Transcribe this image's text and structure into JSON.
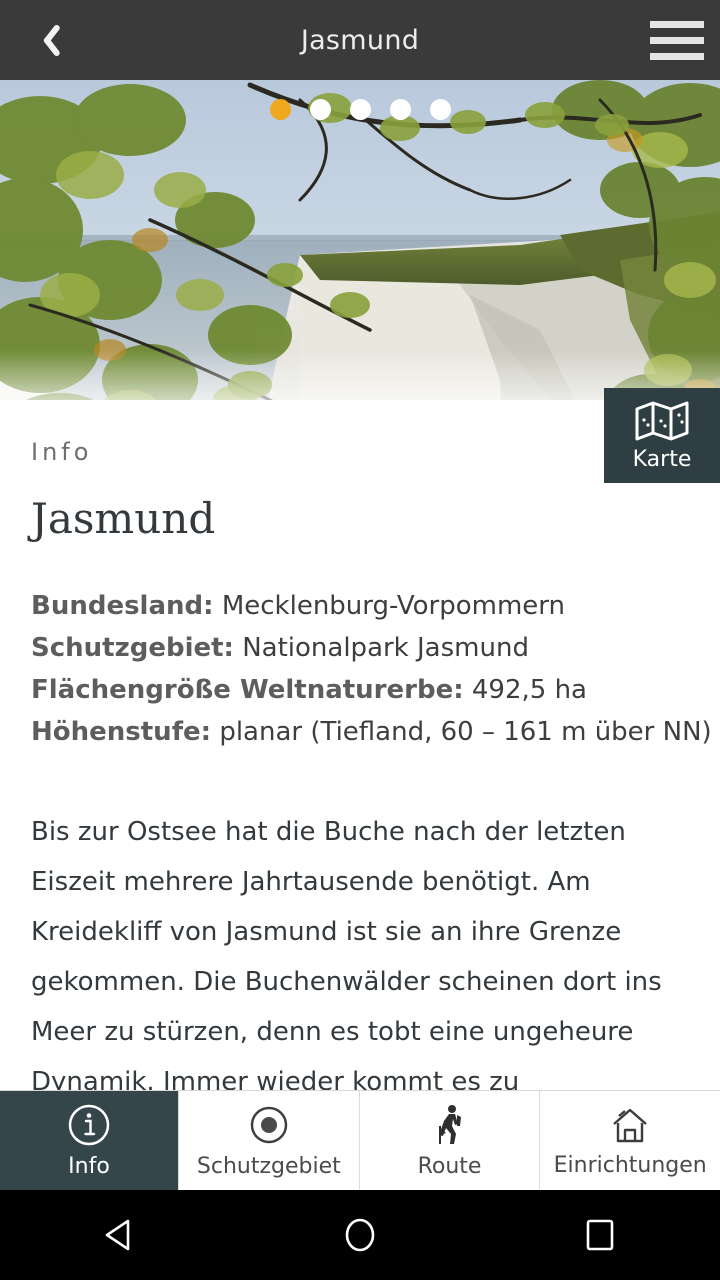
{
  "header": {
    "title": "Jasmund",
    "back_icon": "chevron-left-icon",
    "menu_icon": "hamburger-menu-icon"
  },
  "hero": {
    "alt": "Kreidefelsen Jasmund chalk cliffs with autumn beech forest over the Baltic Sea",
    "carousel": {
      "total": 5,
      "active_index": 0,
      "active_color": "#f0a81e",
      "inactive_color": "#ffffff"
    },
    "map_button": {
      "label": "Karte",
      "icon": "folded-map-icon",
      "background": "#2f3e42"
    }
  },
  "content": {
    "section_label": "Info",
    "title": "Jasmund",
    "facts": [
      {
        "label": "Bundesland:",
        "value": "Mecklenburg-Vorpommern"
      },
      {
        "label": "Schutzgebiet:",
        "value": "Nationalpark Jasmund"
      },
      {
        "label": "Flächengröße Weltnaturerbe:",
        "value": "492,5 ha"
      },
      {
        "label": "Höhenstufe:",
        "value": "planar (Tiefland, 60 – 161 m über NN)"
      }
    ],
    "body": "Bis zur Ostsee hat die Buche nach der letzten Eiszeit mehrere Jahrtausende benötigt. Am Kreidekliff von Jasmund ist sie an ihre Grenze gekommen. Die Buchenwälder scheinen dort ins Meer zu stürzen, denn es tobt eine ungeheure Dynamik. Immer wieder kommt es zu Gesteinsabbrüchen. Immer wieder versucht die Pflanzenwelt Fuß zu fassen. An den Steilhängen der"
  },
  "tabs": [
    {
      "label": "Info",
      "icon": "info-circle-icon",
      "active": true
    },
    {
      "label": "Schutzgebiet",
      "icon": "circle-dot-icon",
      "active": false
    },
    {
      "label": "Route",
      "icon": "hiker-icon",
      "active": false
    },
    {
      "label": "Einrichtungen",
      "icon": "house-outline-icon",
      "active": false
    }
  ],
  "android_nav": {
    "back": "triangle-back-icon",
    "home": "circle-home-icon",
    "recents": "square-recents-icon"
  }
}
